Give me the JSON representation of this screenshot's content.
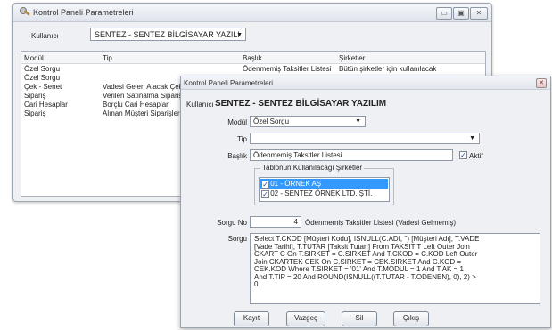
{
  "back_window": {
    "title": "Kontrol Paneli Parametreleri",
    "user_label": "Kullanıcı",
    "user_value": "SENTEZ - SENTEZ BİLGİSAYAR YAZILI",
    "columns": [
      "Modül",
      "Tip",
      "Başlık",
      "Şirketler"
    ],
    "rows": [
      {
        "modul": "Özel Sorgu",
        "tip": "",
        "baslik": "Ödenmemiş Taksitler Listesi",
        "sirket": "Bütün şirketler için kullanılacak"
      },
      {
        "modul": "Özel Sorgu",
        "tip": "",
        "baslik": "",
        "sirket": ""
      },
      {
        "modul": "Çek - Senet",
        "tip": "Vadesi Gelen Alacak Çek",
        "baslik": "",
        "sirket": ""
      },
      {
        "modul": "Sipariş",
        "tip": "Verilen Satınalma Siparişl",
        "baslik": "",
        "sirket": ""
      },
      {
        "modul": "Cari Hesaplar",
        "tip": "Borçlu Cari Hesaplar",
        "baslik": "",
        "sirket": ""
      },
      {
        "modul": "Sipariş",
        "tip": "Alınan Müşteri Siparişleri",
        "baslik": "",
        "sirket": ""
      }
    ]
  },
  "front_window": {
    "title": "Kontrol Paneli Parametreleri",
    "user_label": "Kullanıcı",
    "user_value": "SENTEZ - SENTEZ BİLGİSAYAR YAZILIM",
    "modul_label": "Modül",
    "modul_value": "Özel Sorgu",
    "tip_label": "Tip",
    "tip_value": "",
    "baslik_label": "Başlık",
    "baslik_value": "Ödenmemiş Taksitler Listesi",
    "aktif_label": "Aktif",
    "group_title": "Tablonun Kullanılacağı Şirketler",
    "companies": [
      {
        "label": "01 - ÖRNEK AŞ",
        "checked": true,
        "selected": true
      },
      {
        "label": "02 - SENTEZ ÖRNEK LTD. ŞTİ.",
        "checked": true,
        "selected": false
      }
    ],
    "sorgu_no_label": "Sorgu No",
    "sorgu_no_value": "4",
    "sorgu_no_desc": "Ödenmemiş Taksitler Listesi (Vadesi Gelmemiş)",
    "sorgu_label": "Sorgu",
    "sorgu_lines": [
      "Select T.CKOD [Müşteri Kodu], ISNULL(C.ADI, '') [Müşteri Adı], T.VADE",
      "[Vade Tarihi], T.TUTAR [Taksit Tutarı] From TAKSIT T Left Outer Join",
      "CKART C On T.SIRKET = C.SIRKET And T.CKOD = C.KOD Left Outer",
      "Join CKARTEK CEK On C.SIRKET = CEK.SIRKET And C.KOD =",
      "CEK.KOD Where T.SIRKET = '01' And T.MODUL = 1 And T.AK = 1",
      "And T.TIP = 20 And ROUND(ISNULL((T.TUTAR - T.ODENEN), 0), 2) >",
      "0"
    ],
    "buttons": {
      "save": "Kayıt",
      "cancel": "Vazgeç",
      "delete": "Sil",
      "exit": "Çıkış"
    }
  }
}
